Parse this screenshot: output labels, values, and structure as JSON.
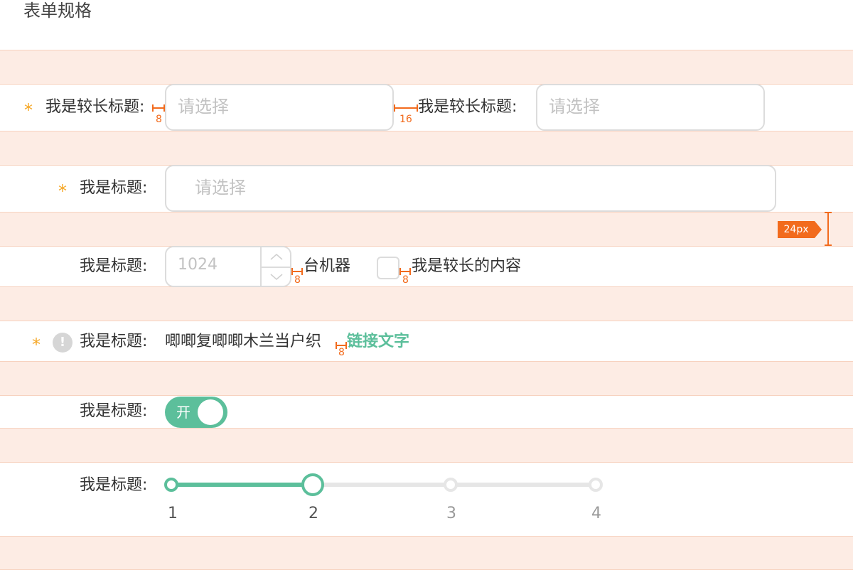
{
  "page": {
    "title": "表单规格"
  },
  "colors": {
    "accent": "#5cbf9b",
    "required": "#f5a623",
    "annotation": "#f26b1d",
    "band": "#fdece4"
  },
  "row1": {
    "field1": {
      "label": "我是较长标题:",
      "placeholder": "请选择"
    },
    "field2": {
      "label": "我是较长标题:",
      "placeholder": "请选择"
    },
    "gap1": "8",
    "gap2": "16"
  },
  "row2": {
    "label": "我是标题:",
    "placeholder": "请选择"
  },
  "spacing_badge": "24px",
  "row3": {
    "label": "我是标题:",
    "stepper_value": "1024",
    "unit": "台机器",
    "checkbox_label": "我是较长的内容",
    "gap1": "8",
    "gap2": "8"
  },
  "row4": {
    "info_icon": "!",
    "label": "我是标题:",
    "text": "唧唧复唧唧木兰当户织",
    "gap": "8",
    "link": "链接文字"
  },
  "row5": {
    "label": "我是标题:",
    "switch_text": "开",
    "switch_on": true
  },
  "row6": {
    "label": "我是标题:",
    "ticks": [
      "1",
      "2",
      "3",
      "4"
    ],
    "value": "2",
    "min": "1",
    "max": "4"
  }
}
